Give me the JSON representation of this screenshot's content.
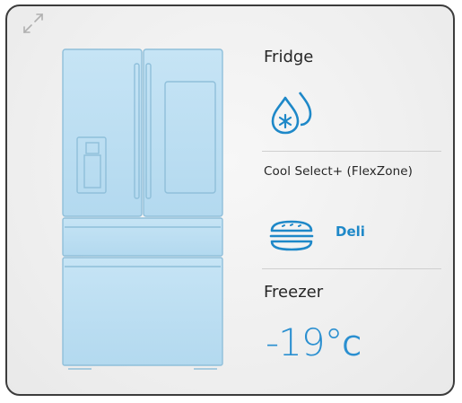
{
  "fridge": {
    "label": "Fridge",
    "mode_icon": "ice-drops-icon"
  },
  "flexzone": {
    "label": "Cool Select+ (FlexZone)",
    "mode_label": "Deli",
    "mode_icon": "sandwich-icon"
  },
  "freezer": {
    "label": "Freezer",
    "temperature": "-19°",
    "unit": "C"
  },
  "colors": {
    "accent": "#2a8fd0",
    "appliance_fill": "#bfe0f2",
    "appliance_stroke": "#8fbfda"
  }
}
